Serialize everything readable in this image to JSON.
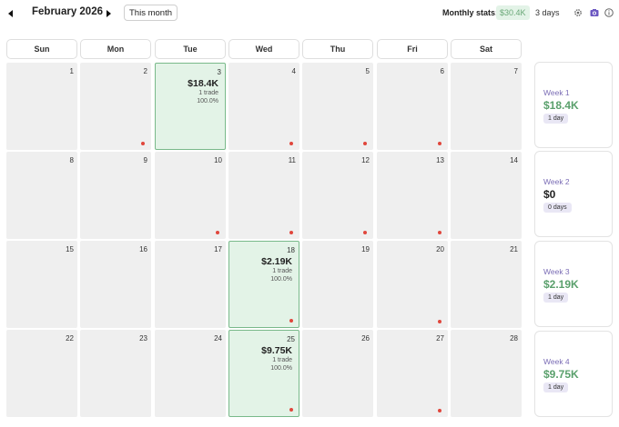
{
  "header": {
    "month_title": "February 2026",
    "this_month_label": "This month",
    "stats_label": "Monthly stats:",
    "stats_value": "$30.4K",
    "stats_days": "3 days",
    "icons": [
      "prev-arrow",
      "next-arrow",
      "gear-icon",
      "camera-icon",
      "info-icon"
    ]
  },
  "weekdays": [
    "Sun",
    "Mon",
    "Tue",
    "Wed",
    "Thu",
    "Fri",
    "Sat"
  ],
  "weeks": [
    {
      "days": [
        {
          "num": "1",
          "dot": false
        },
        {
          "num": "2",
          "dot": true
        },
        {
          "num": "3",
          "dot": false,
          "trade": {
            "pnl": "$18.4K",
            "count": "1 trade",
            "winrate": "100.0%"
          }
        },
        {
          "num": "4",
          "dot": true
        },
        {
          "num": "5",
          "dot": true
        },
        {
          "num": "6",
          "dot": true
        },
        {
          "num": "7",
          "dot": false
        }
      ],
      "summary": {
        "label": "Week 1",
        "pnl": "$18.4K",
        "days": "1 day",
        "positive": true
      }
    },
    {
      "days": [
        {
          "num": "8",
          "dot": false
        },
        {
          "num": "9",
          "dot": false
        },
        {
          "num": "10",
          "dot": true
        },
        {
          "num": "11",
          "dot": true
        },
        {
          "num": "12",
          "dot": true
        },
        {
          "num": "13",
          "dot": true
        },
        {
          "num": "14",
          "dot": false
        }
      ],
      "summary": {
        "label": "Week 2",
        "pnl": "$0",
        "days": "0 days",
        "positive": false
      }
    },
    {
      "days": [
        {
          "num": "15",
          "dot": false
        },
        {
          "num": "16",
          "dot": false
        },
        {
          "num": "17",
          "dot": false
        },
        {
          "num": "18",
          "dot": true,
          "trade": {
            "pnl": "$2.19K",
            "count": "1 trade",
            "winrate": "100.0%"
          }
        },
        {
          "num": "19",
          "dot": false
        },
        {
          "num": "20",
          "dot": true
        },
        {
          "num": "21",
          "dot": false
        }
      ],
      "summary": {
        "label": "Week 3",
        "pnl": "$2.19K",
        "days": "1 day",
        "positive": true
      }
    },
    {
      "days": [
        {
          "num": "22",
          "dot": false
        },
        {
          "num": "23",
          "dot": false
        },
        {
          "num": "24",
          "dot": false
        },
        {
          "num": "25",
          "dot": true,
          "trade": {
            "pnl": "$9.75K",
            "count": "1 trade",
            "winrate": "100.0%"
          }
        },
        {
          "num": "26",
          "dot": false
        },
        {
          "num": "27",
          "dot": true
        },
        {
          "num": "28",
          "dot": false
        }
      ],
      "summary": {
        "label": "Week 4",
        "pnl": "$9.75K",
        "days": "1 day",
        "positive": true
      }
    }
  ],
  "colors": {
    "positive": "#5aa06c",
    "neutral": "#222222",
    "dot": "#e0463c",
    "trade_bg": "#e3f3e7",
    "trade_border": "#79b98a",
    "week_label": "#7a6cb5"
  }
}
